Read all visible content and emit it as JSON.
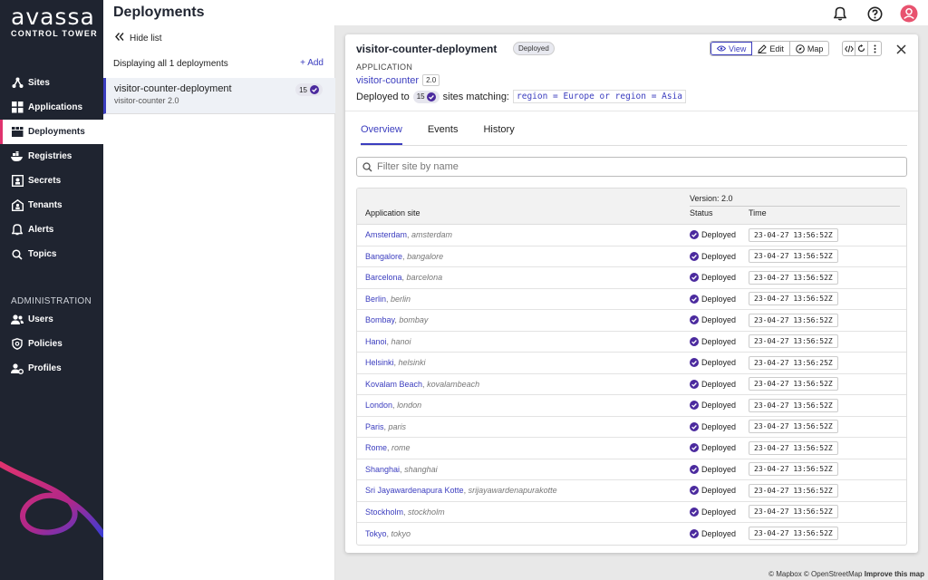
{
  "brand": {
    "name": "avassa",
    "sub": "CONTROL TOWER"
  },
  "sidebar": {
    "items": [
      {
        "label": "Sites",
        "icon": "sites-icon"
      },
      {
        "label": "Applications",
        "icon": "applications-icon"
      },
      {
        "label": "Deployments",
        "icon": "deployments-icon"
      },
      {
        "label": "Registries",
        "icon": "registries-icon"
      },
      {
        "label": "Secrets",
        "icon": "secrets-icon"
      },
      {
        "label": "Tenants",
        "icon": "tenants-icon"
      },
      {
        "label": "Alerts",
        "icon": "bell-icon"
      },
      {
        "label": "Topics",
        "icon": "search-icon"
      }
    ],
    "admin_heading": "ADMINISTRATION",
    "admin_items": [
      {
        "label": "Users",
        "icon": "users-icon"
      },
      {
        "label": "Policies",
        "icon": "policies-icon"
      },
      {
        "label": "Profiles",
        "icon": "profiles-icon"
      }
    ]
  },
  "header": {
    "title": "Deployments"
  },
  "list": {
    "hide_label": "Hide list",
    "displaying": "Displaying all 1 deployments",
    "add_label": "Add",
    "items": [
      {
        "name": "visitor-counter-deployment",
        "sub": "visitor-counter 2.0",
        "count": "15"
      }
    ]
  },
  "detail": {
    "title": "visitor-counter-deployment",
    "status": "Deployed",
    "buttons": {
      "view": "View",
      "edit": "Edit",
      "map": "Map"
    },
    "app_heading": "APPLICATION",
    "app_name": "visitor-counter",
    "app_version": "2.0",
    "deployed_to": "Deployed to",
    "sites_count": "15",
    "sites_matching": "sites matching:",
    "match_expr": "region = Europe or region = Asia",
    "tabs": [
      "Overview",
      "Events",
      "History"
    ],
    "filter_placeholder": "Filter site by name",
    "table": {
      "col_site": "Application site",
      "version": "Version: 2.0",
      "col_status": "Status",
      "col_time": "Time",
      "rows": [
        {
          "name": "Amsterdam",
          "alias": "amsterdam",
          "status": "Deployed",
          "time": "23-04-27 13:56:52Z"
        },
        {
          "name": "Bangalore",
          "alias": "bangalore",
          "status": "Deployed",
          "time": "23-04-27 13:56:52Z"
        },
        {
          "name": "Barcelona",
          "alias": "barcelona",
          "status": "Deployed",
          "time": "23-04-27 13:56:52Z"
        },
        {
          "name": "Berlin",
          "alias": "berlin",
          "status": "Deployed",
          "time": "23-04-27 13:56:52Z"
        },
        {
          "name": "Bombay",
          "alias": "bombay",
          "status": "Deployed",
          "time": "23-04-27 13:56:52Z"
        },
        {
          "name": "Hanoi",
          "alias": "hanoi",
          "status": "Deployed",
          "time": "23-04-27 13:56:52Z"
        },
        {
          "name": "Helsinki",
          "alias": "helsinki",
          "status": "Deployed",
          "time": "23-04-27 13:56:25Z"
        },
        {
          "name": "Kovalam Beach",
          "alias": "kovalambeach",
          "status": "Deployed",
          "time": "23-04-27 13:56:52Z"
        },
        {
          "name": "London",
          "alias": "london",
          "status": "Deployed",
          "time": "23-04-27 13:56:52Z"
        },
        {
          "name": "Paris",
          "alias": "paris",
          "status": "Deployed",
          "time": "23-04-27 13:56:52Z"
        },
        {
          "name": "Rome",
          "alias": "rome",
          "status": "Deployed",
          "time": "23-04-27 13:56:52Z"
        },
        {
          "name": "Shanghai",
          "alias": "shanghai",
          "status": "Deployed",
          "time": "23-04-27 13:56:52Z"
        },
        {
          "name": "Sri Jayawardenapura Kotte",
          "alias": "srijayawardenapurakotte",
          "status": "Deployed",
          "time": "23-04-27 13:56:52Z"
        },
        {
          "name": "Stockholm",
          "alias": "stockholm",
          "status": "Deployed",
          "time": "23-04-27 13:56:52Z"
        },
        {
          "name": "Tokyo",
          "alias": "tokyo",
          "status": "Deployed",
          "time": "23-04-27 13:56:52Z"
        }
      ]
    }
  },
  "map": {
    "attr1": "© Mapbox © OpenStreetMap",
    "attr2": "Improve this map"
  },
  "colors": {
    "accent": "#3b3dbf",
    "sidebar": "#1f2430",
    "active_border": "#e0336e",
    "deployed": "#4b2a9e"
  }
}
